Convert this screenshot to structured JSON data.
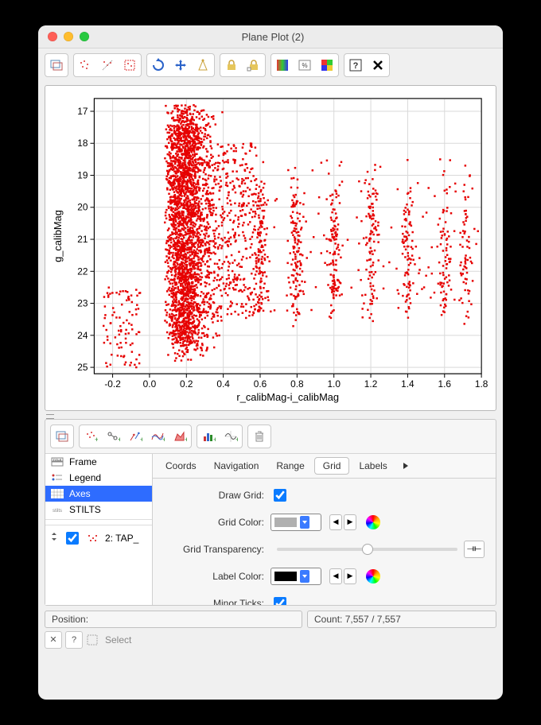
{
  "window": {
    "title": "Plane Plot (2)"
  },
  "chart_data": {
    "type": "scatter",
    "xlabel": "r_calibMag-i_calibMag",
    "ylabel": "g_calibMag",
    "xlim": [
      -0.3,
      1.8
    ],
    "ylim": [
      25.2,
      16.6
    ],
    "xticks": [
      -0.2,
      0.0,
      0.2,
      0.4,
      0.6,
      0.8,
      1.0,
      1.2,
      1.4,
      1.6,
      1.8
    ],
    "yticks": [
      17,
      18,
      19,
      20,
      21,
      22,
      23,
      24,
      25
    ],
    "grid": true,
    "series": [
      {
        "name": "2: TAP_",
        "color": "#e60000",
        "marker": "square",
        "marker_size": 2.5,
        "n_points_shown": 7557,
        "description": "Color-magnitude scatter. Dense main cloud between x≈0.05–0.30 covering y≈17–24.5 with peak density around x≈0.1–0.2, y≈19–22. Sparse tail toward negative x (≈-0.25) at y≈23–25. From x≈0.4 to x≈1.75 points form ~8 discrete vertical stripes centered near x≈0.6, 0.8, 1.0, 1.2, 1.4, 1.6, 1.7, each stripe clustered mainly y≈20–23 with decreasing point count toward higher x.",
        "approx_density_regions": [
          {
            "x_range": [
              0.05,
              0.3
            ],
            "y_range": [
              17.0,
              24.5
            ],
            "relative_density": 1.0
          },
          {
            "x_range": [
              -0.25,
              0.05
            ],
            "y_range": [
              22.0,
              25.0
            ],
            "relative_density": 0.05
          },
          {
            "x_range": [
              0.3,
              0.55
            ],
            "y_range": [
              18.5,
              23.5
            ],
            "relative_density": 0.2
          },
          {
            "x_range": [
              0.55,
              1.75
            ],
            "y_range": [
              19.5,
              23.5
            ],
            "relative_density": 0.1,
            "stripe_centers_x": [
              0.6,
              0.8,
              1.0,
              1.2,
              1.4,
              1.6,
              1.72
            ],
            "stripe_width": 0.05
          }
        ]
      }
    ]
  },
  "tree": {
    "items": [
      {
        "label": "Frame"
      },
      {
        "label": "Legend"
      },
      {
        "label": "Axes",
        "selected": true
      },
      {
        "label": "STILTS"
      }
    ],
    "layer": {
      "label": "2: TAP_",
      "checked": true
    }
  },
  "tabs": {
    "items": [
      "Coords",
      "Navigation",
      "Range",
      "Grid",
      "Labels"
    ],
    "active": "Grid"
  },
  "form": {
    "draw_grid": {
      "label": "Draw Grid:",
      "checked": true
    },
    "grid_color": {
      "label": "Grid Color:",
      "swatch": "#b0b0b0"
    },
    "grid_transparency": {
      "label": "Grid Transparency:",
      "value": 50
    },
    "label_color": {
      "label": "Label Color:",
      "swatch": "#000000"
    },
    "minor_ticks": {
      "label": "Minor Ticks:",
      "checked": true
    }
  },
  "status": {
    "position_label": "Position:",
    "count_label": "Count:",
    "count_value": "7,557 / 7,557"
  },
  "footer": {
    "select_label": "Select"
  }
}
